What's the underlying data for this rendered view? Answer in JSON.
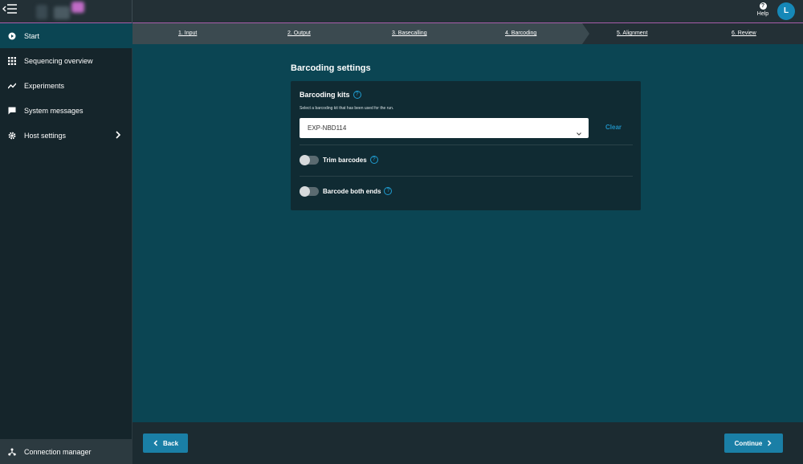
{
  "topbar": {
    "help_label": "Help",
    "help_icon": "?",
    "avatar_initial": "L"
  },
  "sidebar": {
    "items": [
      {
        "label": "Start",
        "icon": "play-circle-icon",
        "active": true
      },
      {
        "label": "Sequencing overview",
        "icon": "grid-icon"
      },
      {
        "label": "Experiments",
        "icon": "trend-icon"
      },
      {
        "label": "System messages",
        "icon": "message-icon"
      },
      {
        "label": "Host settings",
        "icon": "gear-icon"
      }
    ],
    "connection_manager": "Connection manager"
  },
  "stepper": {
    "steps": [
      {
        "label": "1. Input"
      },
      {
        "label": "2. Output"
      },
      {
        "label": "3. Basecalling"
      },
      {
        "label": "4. Barcoding",
        "current": true
      },
      {
        "label": "5. Alignment"
      },
      {
        "label": "6. Review"
      }
    ]
  },
  "main": {
    "section_title": "Barcoding settings",
    "kits_label": "Barcoding kits",
    "kits_description": "Select a barcoding kit that has been used for the run.",
    "selected_kit": "EXP-NBD114",
    "clear_label": "Clear",
    "trim_label": "Trim barcodes",
    "trim_on": false,
    "both_ends_label": "Barcode both ends",
    "both_ends_on": false,
    "info_icon": "?"
  },
  "footer": {
    "back_label": "Back",
    "continue_label": "Continue"
  },
  "colors": {
    "accent": "#1a7fa6",
    "main_bg": "#0b4553",
    "sidebar_bg": "#15252b",
    "brand_line": "#a85dab"
  }
}
